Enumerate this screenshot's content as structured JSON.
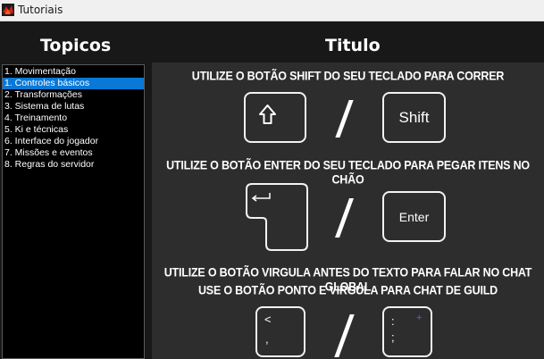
{
  "window": {
    "title": "Tutoriais"
  },
  "sidebar": {
    "heading": "Topicos",
    "items": [
      {
        "label": "1. Movimentação",
        "selected": false
      },
      {
        "label": "1. Controles básicos",
        "selected": true
      },
      {
        "label": "2. Transformações",
        "selected": false
      },
      {
        "label": "3. Sistema de lutas",
        "selected": false
      },
      {
        "label": "4. Treinamento",
        "selected": false
      },
      {
        "label": "5. Ki e técnicas",
        "selected": false
      },
      {
        "label": "6. Interface do jogador",
        "selected": false
      },
      {
        "label": "7. Missões e eventos",
        "selected": false
      },
      {
        "label": "8. Regras do servidor",
        "selected": false
      }
    ]
  },
  "content": {
    "heading": "Titulo",
    "instructions": {
      "shift": "UTILIZE O BOTÃO SHIFT DO SEU TECLADO PARA CORRER",
      "enter": "UTILIZE O BOTÃO ENTER DO SEU TECLADO PARA PEGAR ITENS NO CHÃO",
      "comma": "UTILIZE O BOTÃO VIRGULA ANTES DO TEXTO PARA FALAR NO CHAT GLOBAL",
      "semicolon": "USE O BOTÃO PONTO E VIRGULA PARA CHAT DE GUILD"
    },
    "keys": {
      "shift_label": "Shift",
      "enter_label": "Enter",
      "comma_top": "<",
      "comma_bottom": ",",
      "semicolon_top": ":",
      "semicolon_bottom": ";",
      "semicolon_plus": "+"
    }
  },
  "colors": {
    "selection": "#0a78d7",
    "panel": "#2d2d2d",
    "background": "#181818"
  }
}
